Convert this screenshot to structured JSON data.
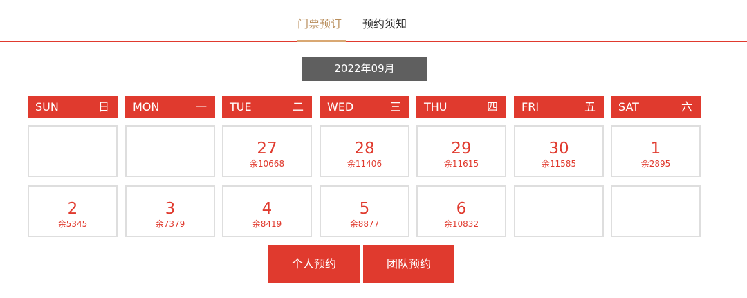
{
  "tabs": [
    {
      "label": "门票预订",
      "active": true
    },
    {
      "label": "预约须知",
      "active": false
    }
  ],
  "calendar": {
    "month_label": "2022年09月",
    "weekdays": [
      {
        "en": "SUN",
        "zh": "日"
      },
      {
        "en": "MON",
        "zh": "一"
      },
      {
        "en": "TUE",
        "zh": "二"
      },
      {
        "en": "WED",
        "zh": "三"
      },
      {
        "en": "THU",
        "zh": "四"
      },
      {
        "en": "FRI",
        "zh": "五"
      },
      {
        "en": "SAT",
        "zh": "六"
      }
    ],
    "weeks": [
      [
        null,
        null,
        {
          "day": "27",
          "remain": "余10668"
        },
        {
          "day": "28",
          "remain": "余11406"
        },
        {
          "day": "29",
          "remain": "余11615"
        },
        {
          "day": "30",
          "remain": "余11585"
        },
        {
          "day": "1",
          "remain": "余2895"
        }
      ],
      [
        {
          "day": "2",
          "remain": "余5345"
        },
        {
          "day": "3",
          "remain": "余7379"
        },
        {
          "day": "4",
          "remain": "余8419"
        },
        {
          "day": "5",
          "remain": "余8877"
        },
        {
          "day": "6",
          "remain": "余10832"
        },
        null,
        null
      ]
    ]
  },
  "actions": {
    "personal_label": "个人预约",
    "group_label": "团队预约"
  },
  "colors": {
    "accent": "#e03a2e",
    "tab_active": "#b98e5c",
    "month_bg": "#5f5f5f",
    "cell_border": "#dedede"
  }
}
